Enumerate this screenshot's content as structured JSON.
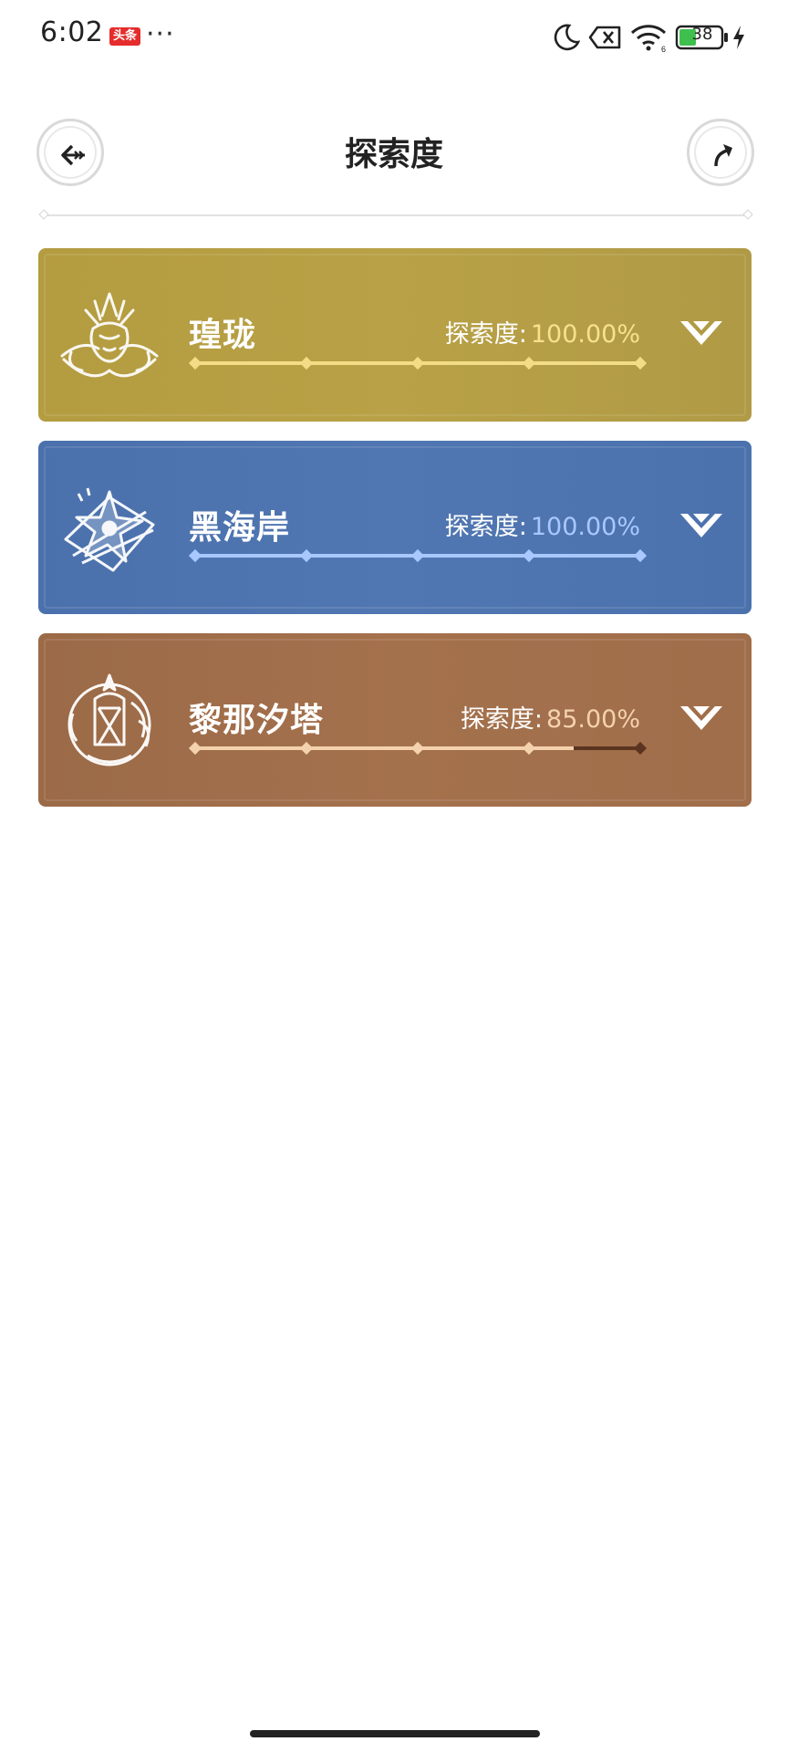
{
  "status_bar": {
    "time": "6:02",
    "app_badge": "头条",
    "more": "···",
    "battery": "38"
  },
  "header": {
    "title": "探索度",
    "back_icon": "back-arrow-icon",
    "share_icon": "share-arrow-icon"
  },
  "regions": [
    {
      "name": "瑝珑",
      "progress_label": "探索度:",
      "progress_value": "100.00%",
      "progress": 1.0,
      "emblem": "dragon-emblem-icon",
      "colors": {
        "bg": "#b49c40",
        "value": "#f7e18f",
        "bar": "#f3dc86",
        "bar_remaining": "#f3dc86"
      }
    },
    {
      "name": "黑海岸",
      "progress_label": "探索度:",
      "progress_value": "100.00%",
      "progress": 1.0,
      "emblem": "star-flower-emblem-icon",
      "colors": {
        "bg": "#4b71ad",
        "value": "#a8c8ff",
        "bar": "#a8c8ff",
        "bar_remaining": "#a8c8ff"
      }
    },
    {
      "name": "黎那汐塔",
      "progress_label": "探索度:",
      "progress_value": "85.00%",
      "progress": 0.85,
      "emblem": "lantern-emblem-icon",
      "colors": {
        "bg": "#9b6a47",
        "value": "#f4d2ad",
        "bar": "#f4d2ad",
        "bar_remaining": "#5b3420"
      }
    }
  ]
}
